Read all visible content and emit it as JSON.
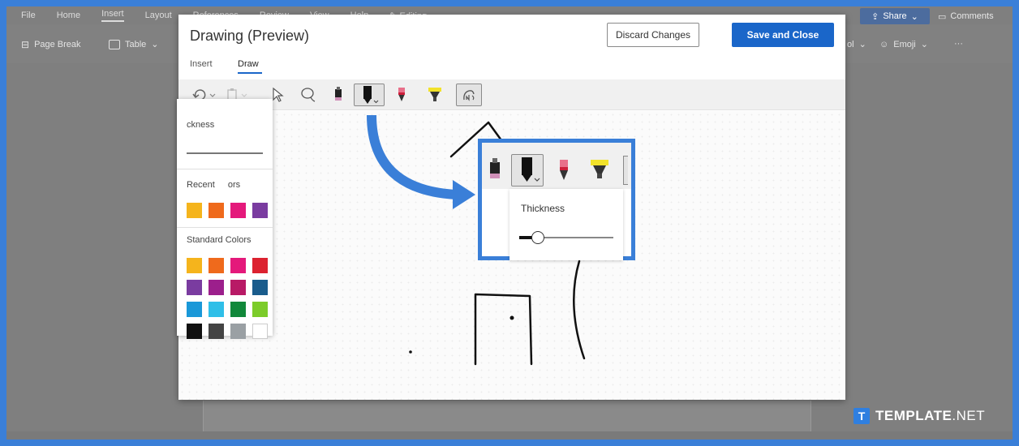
{
  "app": {
    "ribbon_tabs": [
      "File",
      "Home",
      "Insert",
      "Layout",
      "References",
      "Review",
      "View",
      "Help",
      "Editing"
    ],
    "active_tab": "Insert",
    "ribbon_items": {
      "page_break": "Page Break",
      "table": "Table",
      "symbol_tail": "ol",
      "emoji": "Emoji",
      "more": "···"
    },
    "share": "Share",
    "comments": "Comments"
  },
  "dialog": {
    "title": "Drawing (Preview)",
    "discard_label": "Discard Changes",
    "save_label": "Save and Close",
    "tabs": [
      "Insert",
      "Draw"
    ],
    "active_tab": "Draw"
  },
  "pen_dropdown": {
    "thickness_label": "ckness",
    "recent_label": "Recent",
    "recent_tail": "ors",
    "recent_colors": [
      "#f5b41c",
      "#ef6a1c",
      "#e4197b",
      "#7a3ca0"
    ],
    "standard_label": "Standard Colors",
    "standard_colors": [
      [
        "#f5b41c",
        "#ef6a1c",
        "#e4197b",
        "#dc2230"
      ],
      [
        "#7a3ca0",
        "#9c1f8c",
        "#b81a66",
        "#1a5c8c"
      ],
      [
        "#1a98d8",
        "#2fbfe8",
        "#11883a",
        "#7ccc2a"
      ],
      [
        "#111111",
        "#444444",
        "#9aa0a4",
        "#ffffff"
      ]
    ]
  },
  "callout": {
    "thickness_label": "Thickness",
    "thickness_level": 0.2
  },
  "colors": {
    "accent": "#1a66c9",
    "highlight_blue": "#3a7fd8"
  },
  "watermark": {
    "logo": "T",
    "brand_bold": "TEMPLATE",
    "brand_light": ".NET"
  }
}
